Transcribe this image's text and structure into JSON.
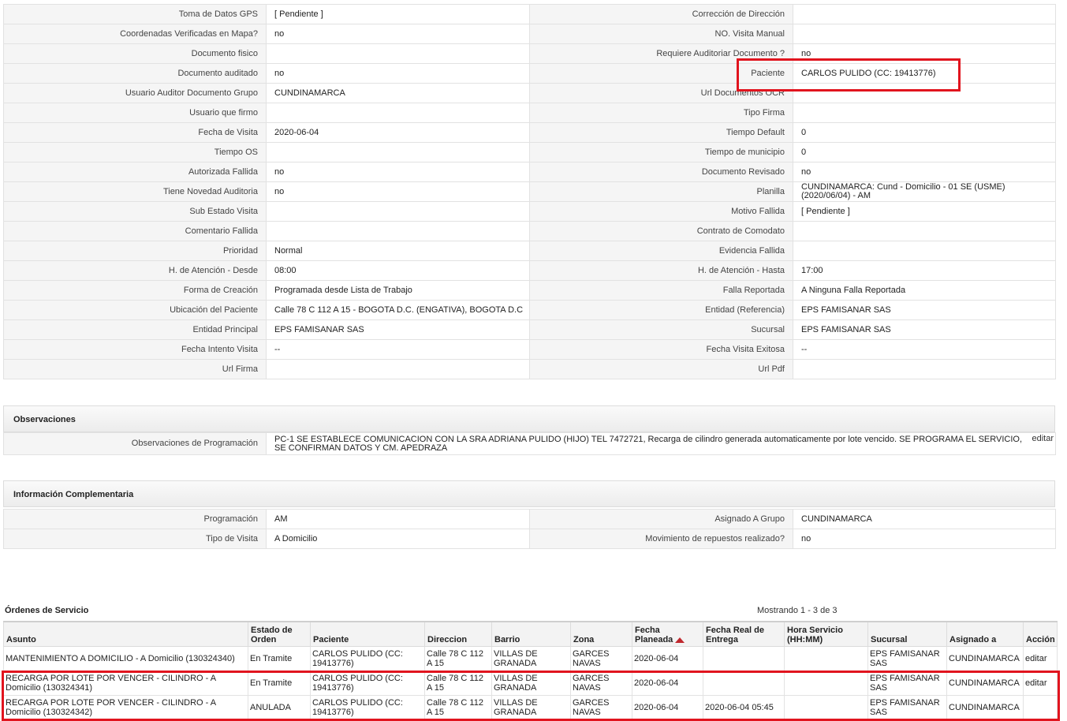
{
  "details": {
    "rows": [
      {
        "l1": "Toma de Datos GPS",
        "v1": "[ Pendiente ]",
        "l2": "Corrección de Dirección",
        "v2": ""
      },
      {
        "l1": "Coordenadas Verificadas en Mapa?",
        "v1": "no",
        "l2": "NO. Visita Manual",
        "v2": ""
      },
      {
        "l1": "Documento fisico",
        "v1": "",
        "l2": "Requiere Auditoriar Documento ?",
        "v2": "no"
      },
      {
        "l1": "Documento auditado",
        "v1": "no",
        "l2": "Paciente",
        "v2": "CARLOS PULIDO (CC: 19413776)"
      },
      {
        "l1": "Usuario Auditor Documento Grupo",
        "v1": "CUNDINAMARCA",
        "l2": "Url Documentos OCR",
        "v2": ""
      },
      {
        "l1": "Usuario que firmo",
        "v1": "",
        "l2": "Tipo Firma",
        "v2": ""
      },
      {
        "l1": "Fecha de Visita",
        "v1": "2020-06-04",
        "l2": "Tiempo Default",
        "v2": "0"
      },
      {
        "l1": "Tiempo OS",
        "v1": "",
        "l2": "Tiempo de municipio",
        "v2": "0"
      },
      {
        "l1": "Autorizada Fallida",
        "v1": "no",
        "l2": "Documento Revisado",
        "v2": "no"
      },
      {
        "l1": "Tiene Novedad Auditoria",
        "v1": "no",
        "l2": "Planilla",
        "v2": "CUNDINAMARCA: Cund - Domicilio - 01 SE (USME) (2020/06/04) - AM"
      },
      {
        "l1": "Sub Estado Visita",
        "v1": "",
        "l2": "Motivo Fallida",
        "v2": "[ Pendiente ]"
      },
      {
        "l1": "Comentario Fallida",
        "v1": "",
        "l2": "Contrato de Comodato",
        "v2": ""
      },
      {
        "l1": "Prioridad",
        "v1": "Normal",
        "l2": "Evidencia Fallida",
        "v2": ""
      },
      {
        "l1": "H. de Atención - Desde",
        "v1": "08:00",
        "l2": "H. de Atención - Hasta",
        "v2": "17:00"
      },
      {
        "l1": "Forma de Creación",
        "v1": "Programada desde Lista de Trabajo",
        "l2": "Falla Reportada",
        "v2": "A Ninguna Falla Reportada"
      },
      {
        "l1": "Ubicación del Paciente",
        "v1": "Calle 78 C 112 A 15 - BOGOTA D.C. (ENGATIVA), BOGOTA D.C",
        "l2": "Entidad (Referencia)",
        "v2": "EPS FAMISANAR SAS"
      },
      {
        "l1": "Entidad Principal",
        "v1": "EPS FAMISANAR SAS",
        "l2": "Sucursal",
        "v2": "EPS FAMISANAR SAS"
      },
      {
        "l1": "Fecha Intento Visita",
        "v1": "--",
        "l2": "Fecha Visita Exitosa",
        "v2": "--"
      },
      {
        "l1": "Url Firma",
        "v1": "",
        "l2": "Url Pdf",
        "v2": ""
      }
    ]
  },
  "observaciones": {
    "title": "Observaciones",
    "label": "Observaciones de Programación",
    "value": "PC-1 SE ESTABLECE COMUNICACION CON LA SRA ADRIANA PULIDO (HIJO) TEL 7472721, Recarga de cilindro generada automaticamente por lote vencido. SE PROGRAMA EL SERVICIO, SE CONFIRMAN DATOS Y CM. APEDRAZA",
    "edit": "editar"
  },
  "info": {
    "title": "Información Complementaria",
    "rows": [
      {
        "l1": "Programación",
        "v1": "AM",
        "l2": "Asignado A Grupo",
        "v2": "CUNDINAMARCA"
      },
      {
        "l1": "Tipo de Visita",
        "v1": "A Domicilio",
        "l2": "Movimiento de repuestos realizado?",
        "v2": "no"
      }
    ]
  },
  "orders": {
    "title": "Órdenes de Servicio",
    "count": "Mostrando 1 - 3 de 3",
    "headers": [
      "Asunto",
      "Estado de Orden",
      "Paciente",
      "Direccion",
      "Barrio",
      "Zona",
      "Fecha Planeada",
      "Fecha Real de Entrega",
      "Hora Servicio (HH:MM)",
      "Sucursal",
      "Asignado a",
      "Acción"
    ],
    "rows": [
      [
        "MANTENIMIENTO A DOMICILIO - A Domicilio (130324340)",
        "En Tramite",
        "CARLOS PULIDO (CC: 19413776)",
        "Calle 78 C 112 A 15",
        "VILLAS DE GRANADA",
        "GARCES NAVAS",
        "2020-06-04",
        "",
        "",
        "EPS FAMISANAR SAS",
        "CUNDINAMARCA",
        "editar"
      ],
      [
        "RECARGA POR LOTE POR VENCER - CILINDRO - A Domicilio (130324341)",
        "En Tramite",
        "CARLOS PULIDO (CC: 19413776)",
        "Calle 78 C 112 A 15",
        "VILLAS DE GRANADA",
        "GARCES NAVAS",
        "2020-06-04",
        "",
        "",
        "EPS FAMISANAR SAS",
        "CUNDINAMARCA",
        "editar"
      ],
      [
        "RECARGA POR LOTE POR VENCER - CILINDRO - A Domicilio (130324342)",
        "ANULADA",
        "CARLOS PULIDO (CC: 19413776)",
        "Calle 78 C 112 A 15",
        "VILLAS DE GRANADA",
        "GARCES NAVAS",
        "2020-06-04",
        "2020-06-04 05:45",
        "",
        "EPS FAMISANAR SAS",
        "CUNDINAMARCA",
        ""
      ]
    ]
  },
  "colors": {
    "highlight": "#e1141e",
    "sort_arrow": "#c0282e"
  }
}
